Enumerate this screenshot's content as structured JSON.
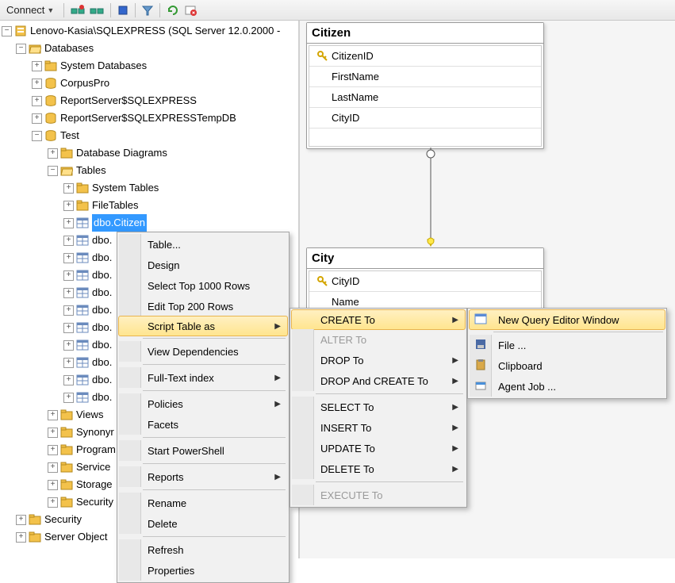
{
  "toolbar": {
    "connect_label": "Connect"
  },
  "server_label": "Lenovo-Kasia\\SQLEXPRESS (SQL Server 12.0.2000 -",
  "tree": {
    "databases": "Databases",
    "system_databases": "System Databases",
    "corpuspro": "CorpusPro",
    "report1": "ReportServer$SQLEXPRESS",
    "report2": "ReportServer$SQLEXPRESSTempDB",
    "test": "Test",
    "dbdiagrams": "Database Diagrams",
    "tables": "Tables",
    "systables": "System Tables",
    "filetables": "FileTables",
    "dbo_citizen": "dbo.Citizen",
    "dbo_short": "dbo.",
    "views": "Views",
    "synonyms": "Synonyr",
    "program": "Program",
    "service": "Service ",
    "storage": "Storage",
    "security_inner": "Security",
    "security": "Security",
    "server_objects": "Server Object"
  },
  "menu1": {
    "table": "Table...",
    "design": "Design",
    "select1000": "Select Top 1000 Rows",
    "edit200": "Edit Top 200 Rows",
    "script": "Script Table as",
    "viewdep": "View Dependencies",
    "fulltext": "Full-Text index",
    "policies": "Policies",
    "facets": "Facets",
    "startps": "Start PowerShell",
    "reports": "Reports",
    "rename": "Rename",
    "delete": "Delete",
    "refresh": "Refresh",
    "properties": "Properties"
  },
  "menu2": {
    "create": "CREATE To",
    "alter": "ALTER To",
    "drop": "DROP To",
    "dropcreate": "DROP And CREATE To",
    "select": "SELECT To",
    "insert": "INSERT To",
    "update": "UPDATE To",
    "delete": "DELETE To",
    "execute": "EXECUTE To"
  },
  "menu3": {
    "newquery": "New Query Editor Window",
    "file": "File ...",
    "clipboard": "Clipboard",
    "agentjob": "Agent Job ..."
  },
  "tables_diag": {
    "citizen": {
      "title": "Citizen",
      "cols": [
        "CitizenID",
        "FirstName",
        "LastName",
        "CityID"
      ]
    },
    "city": {
      "title": "City",
      "cols": [
        "CityID",
        "Name"
      ]
    }
  }
}
